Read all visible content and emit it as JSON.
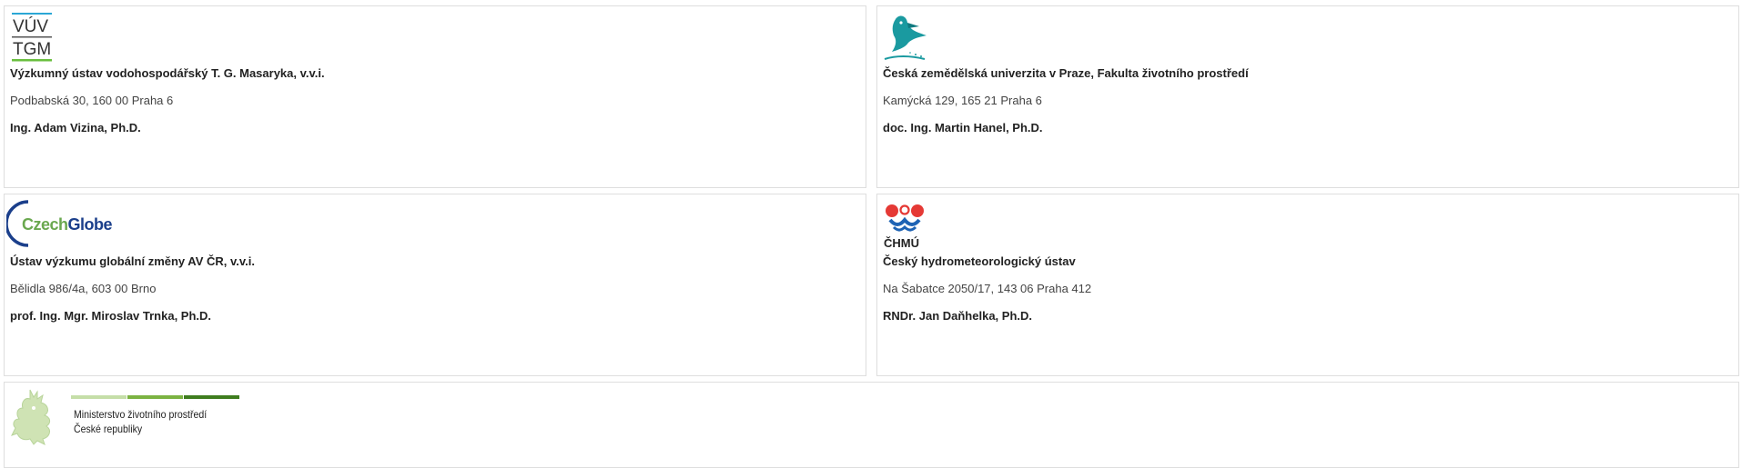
{
  "partners": [
    {
      "logo": {
        "icon": "vuv-tgm-logo",
        "text_top": "VÚV",
        "text_bottom": "TGM",
        "color_top": "#2aa7d6",
        "color_bottom": "#6abf3f"
      },
      "name": "Výzkumný ústav vodohospodářský T. G. Masaryka, v.v.i.",
      "address": "Podbabská 30, 160 00 Praha 6",
      "contact": "Ing. Adam Vizina, Ph.D."
    },
    {
      "logo": {
        "icon": "kingfisher-logo",
        "color": "#1a9aa0"
      },
      "name": "Česká zemědělská univerzita v Praze, Fakulta životního prostředí",
      "address": "Kamýcká 129, 165 21 Praha 6",
      "contact": "doc. Ing. Martin Hanel, Ph.D."
    },
    {
      "logo": {
        "icon": "czechglobe-logo",
        "text_a": "Czech",
        "text_b": "Globe",
        "color_a": "#6aa84f",
        "color_b": "#1b3f8b"
      },
      "name": "Ústav výzkumu globální změny AV ČR, v.v.i.",
      "address": "Bělidla 986/4a, 603 00 Brno",
      "contact": "prof. Ing. Mgr. Miroslav Trnka, Ph.D."
    },
    {
      "logo": {
        "icon": "chmu-logo",
        "text": "ČHMÚ",
        "color_red": "#e53935",
        "color_blue": "#1e63b4"
      },
      "name": "Český hydrometeorologický ústav",
      "address": "Na Šabatce 2050/17, 143 06 Praha 412",
      "contact": "RNDr. Jan Daňhelka, Ph.D."
    }
  ],
  "ministry": {
    "line1": "Ministerstvo životního prostředí",
    "line2": "České republiky",
    "bar_colors": [
      "#c5dea8",
      "#7cb342",
      "#3f7d1f"
    ],
    "lion_color": "#cfe3b4"
  }
}
